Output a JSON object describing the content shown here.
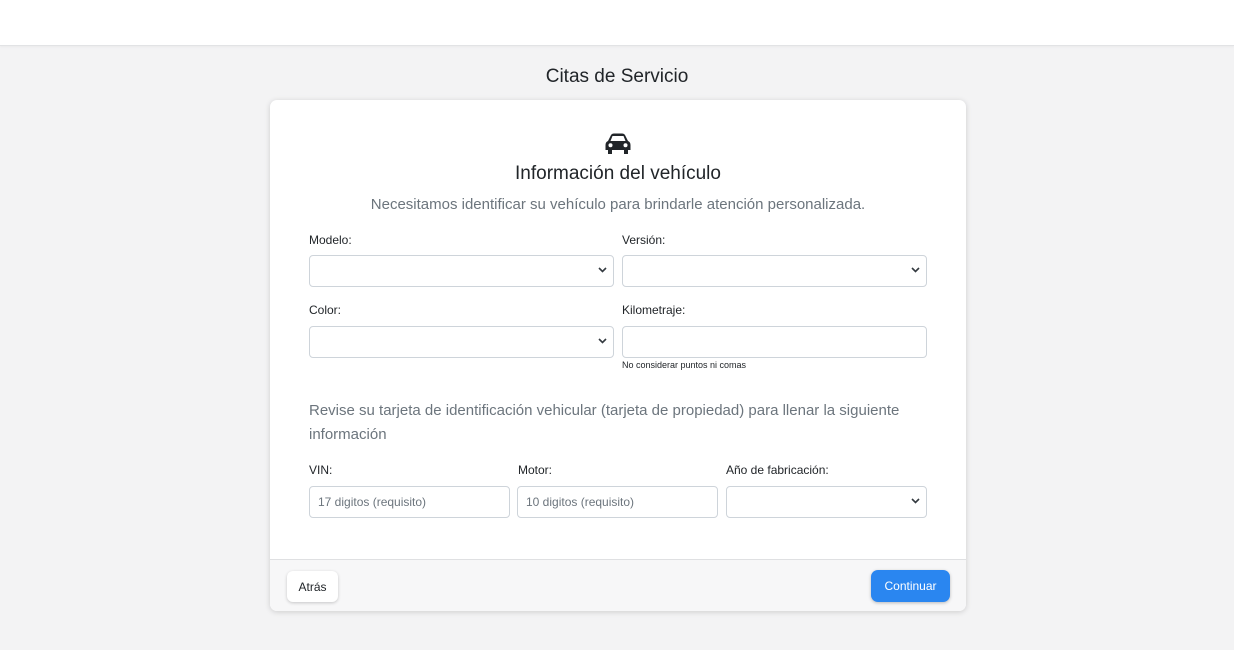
{
  "page": {
    "title": "Citas de Servicio"
  },
  "card": {
    "icon": "car-icon",
    "heading": "Información del vehículo",
    "subtitle": "Necesitamos identificar su vehículo para brindarle atención personalizada."
  },
  "fields": {
    "modelo": {
      "label": "Modelo:",
      "value": ""
    },
    "version": {
      "label": "Versión:",
      "value": ""
    },
    "color": {
      "label": "Color:",
      "value": ""
    },
    "kilometraje": {
      "label": "Kilometraje:",
      "value": "",
      "placeholder": "",
      "help": "No considerar puntos ni comas"
    },
    "vin": {
      "label": "VIN:",
      "value": "",
      "placeholder": "17 digitos (requisito)"
    },
    "motor": {
      "label": "Motor:",
      "value": "",
      "placeholder": "10 digitos (requisito)"
    },
    "anio": {
      "label": "Año de fabricación:",
      "value": ""
    }
  },
  "instructions": "Revise su tarjeta de identificación vehicular (tarjeta de propiedad) para llenar la siguiente información",
  "footer": {
    "back_label": "Atrás",
    "continue_label": "Continuar"
  },
  "colors": {
    "accent": "#2a86f0",
    "background": "#f3f3f4",
    "muted_text": "#6c757d"
  }
}
